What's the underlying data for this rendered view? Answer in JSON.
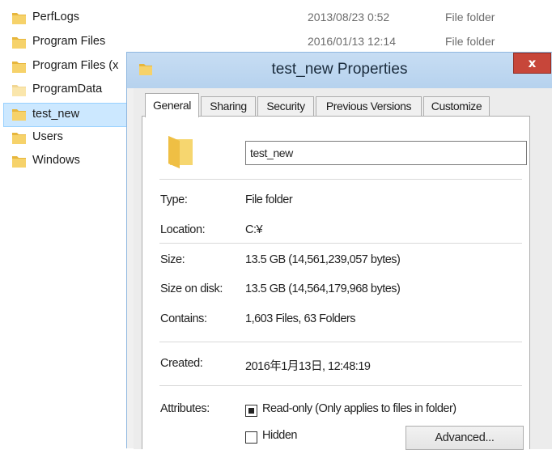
{
  "explorer": {
    "items": [
      {
        "name": "PerfLogs",
        "date": "2013/08/23 0:52",
        "type": "File folder"
      },
      {
        "name": "Program Files",
        "date": "2016/01/13 12:14",
        "type": "File folder"
      },
      {
        "name": "Program Files (x",
        "date": "",
        "type": ""
      },
      {
        "name": "ProgramData",
        "date": "",
        "type": ""
      },
      {
        "name": "test_new",
        "date": "",
        "type": ""
      },
      {
        "name": "Users",
        "date": "",
        "type": ""
      },
      {
        "name": "Windows",
        "date": "",
        "type": ""
      }
    ]
  },
  "dialog": {
    "title": "test_new Properties",
    "close_label": "x",
    "tabs": [
      {
        "label": "General"
      },
      {
        "label": "Sharing"
      },
      {
        "label": "Security"
      },
      {
        "label": "Previous Versions"
      },
      {
        "label": "Customize"
      }
    ],
    "name_value": "test_new",
    "type_label": "Type:",
    "type_value": "File folder",
    "location_label": "Location:",
    "location_value": "C:¥",
    "size_label": "Size:",
    "size_value": "13.5 GB (14,561,239,057 bytes)",
    "size_on_disk_label": "Size on disk:",
    "size_on_disk_value": "13.5 GB (14,564,179,968 bytes)",
    "contains_label": "Contains:",
    "contains_value": "1,603 Files, 63 Folders",
    "created_label": "Created:",
    "created_value": "2016年1月13日, 12:48:19",
    "attributes_label": "Attributes:",
    "readonly_label": "Read-only (Only applies to files in folder)",
    "hidden_label": "Hidden",
    "advanced_label": "Advanced..."
  },
  "colors": {
    "folder_yellow": "#f3cf5a",
    "selection_bg": "#cce8ff",
    "close_red": "#c7463a",
    "titlebar": "#c7ddf3"
  }
}
